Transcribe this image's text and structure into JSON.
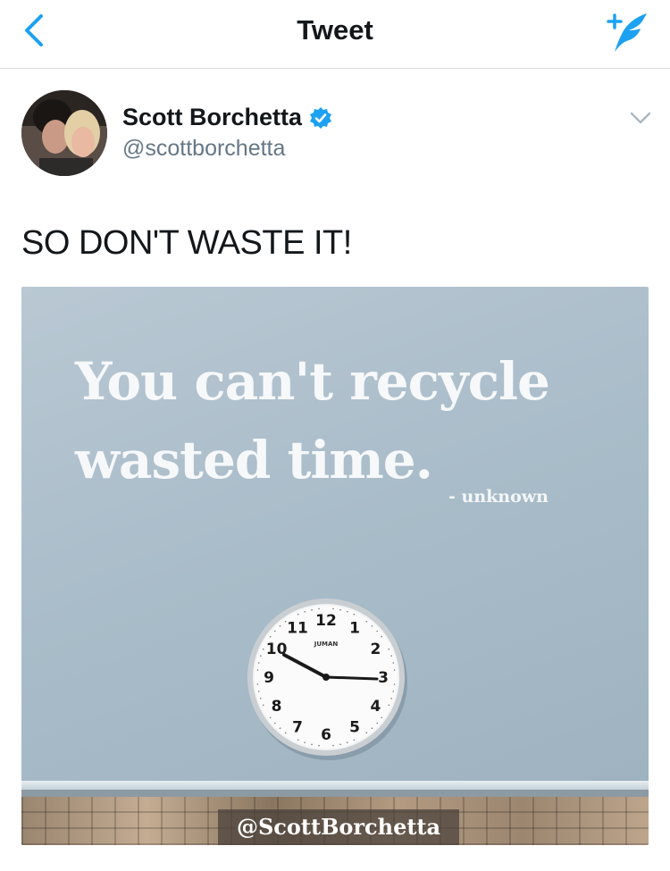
{
  "header": {
    "title": "Tweet",
    "back_icon": "chevron-left-icon",
    "compose_icon": "compose-tweet-icon",
    "accent_color": "#1da1f2"
  },
  "tweet": {
    "author": {
      "display_name": "Scott Borchetta",
      "handle": "@scottborchetta",
      "verified": true
    },
    "text": "SO DON'T WASTE IT!",
    "media": {
      "quote": "You can't recycle wasted time.",
      "attribution": "- unknown",
      "watermark": "@ScottBorchetta",
      "clock_brand": "JUMAN",
      "clock_numbers": [
        "12",
        "1",
        "2",
        "3",
        "4",
        "5",
        "6",
        "7",
        "8",
        "9",
        "10",
        "11"
      ]
    }
  }
}
